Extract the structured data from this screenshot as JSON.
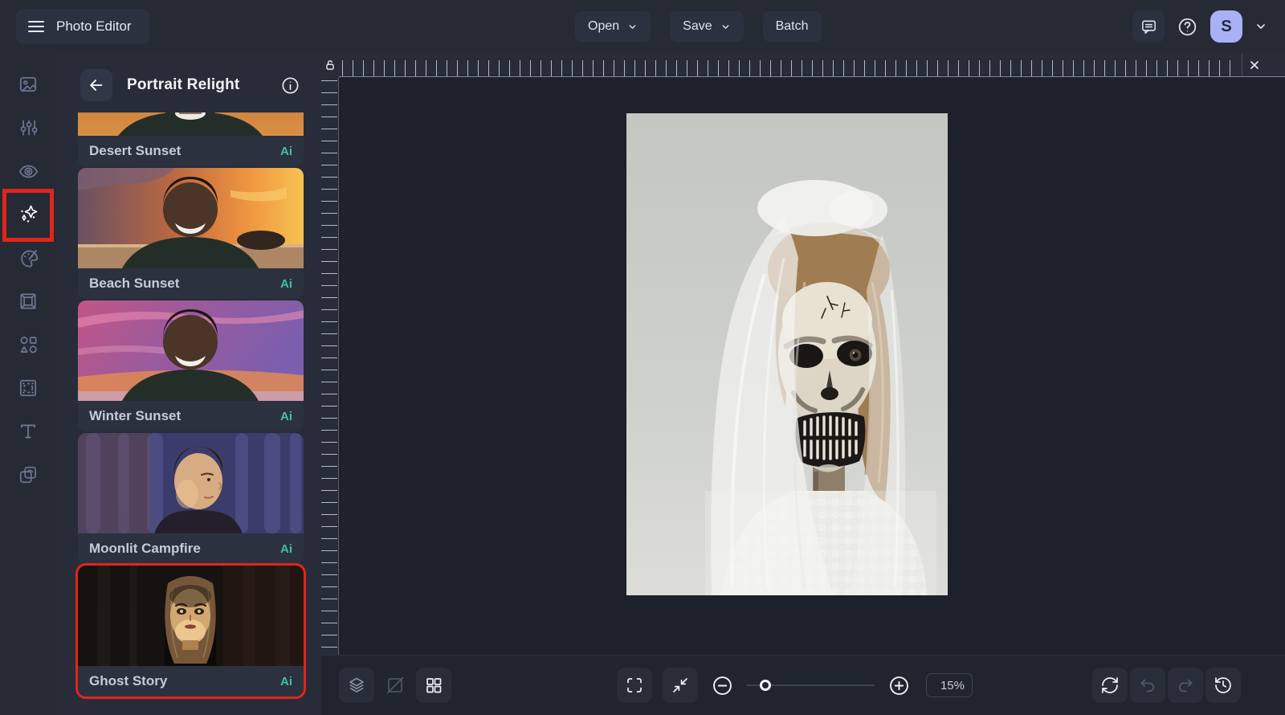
{
  "app": {
    "title": "Photo Editor"
  },
  "topbar": {
    "open_label": "Open",
    "save_label": "Save",
    "batch_label": "Batch",
    "avatar_initial": "S"
  },
  "rail": {
    "items": [
      "image",
      "adjustments",
      "eye",
      "relight-ai",
      "palette",
      "frame",
      "shapes",
      "texture",
      "text",
      "duplicate"
    ],
    "active_item": "relight-ai"
  },
  "panel": {
    "title": "Portrait Relight",
    "presets": [
      {
        "name": "Desert Sunset",
        "badge": "Ai",
        "selected": false
      },
      {
        "name": "Beach Sunset",
        "badge": "Ai",
        "selected": false
      },
      {
        "name": "Winter Sunset",
        "badge": "Ai",
        "selected": false
      },
      {
        "name": "Moonlit Campfire",
        "badge": "Ai",
        "selected": false
      },
      {
        "name": "Ghost Story",
        "badge": "Ai",
        "selected": true
      }
    ]
  },
  "toolbar": {
    "zoom_value": "15%"
  },
  "annotations": {
    "highlight_color": "#e1251b",
    "highlighted": [
      "relight-tool-icon",
      "ghost-story-preset"
    ]
  },
  "colors": {
    "topbar_bg": "#252a35",
    "panel_bg": "#272c38",
    "card_bg": "#2c3140",
    "canvas_bg": "#1d212b",
    "bottombar_bg": "#20242f",
    "ai_badge": "#3fc39e",
    "avatar_bg": "#a9b1f6",
    "accent_red": "#e1251b"
  }
}
